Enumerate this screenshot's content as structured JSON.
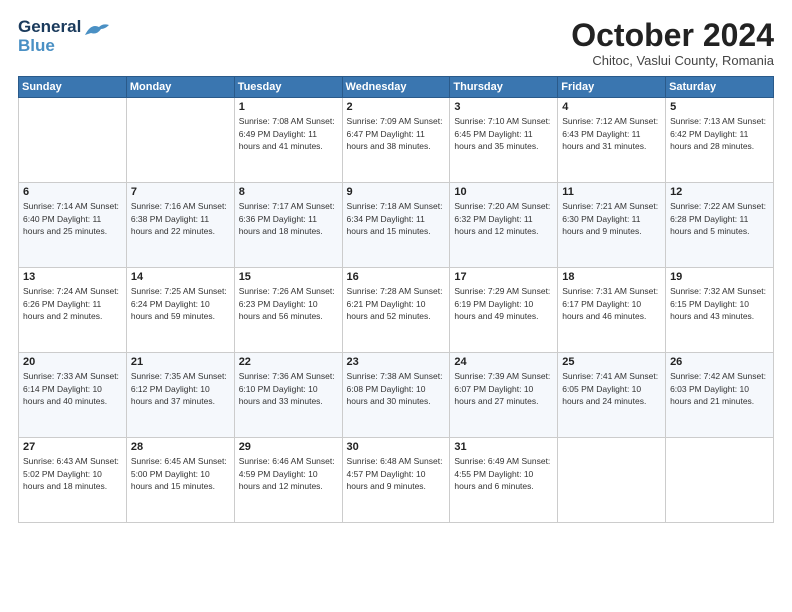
{
  "header": {
    "logo_line1": "General",
    "logo_line2": "Blue",
    "month": "October 2024",
    "location": "Chitoc, Vaslui County, Romania"
  },
  "weekdays": [
    "Sunday",
    "Monday",
    "Tuesday",
    "Wednesday",
    "Thursday",
    "Friday",
    "Saturday"
  ],
  "weeks": [
    [
      {
        "day": "",
        "info": ""
      },
      {
        "day": "",
        "info": ""
      },
      {
        "day": "1",
        "info": "Sunrise: 7:08 AM\nSunset: 6:49 PM\nDaylight: 11 hours and 41 minutes."
      },
      {
        "day": "2",
        "info": "Sunrise: 7:09 AM\nSunset: 6:47 PM\nDaylight: 11 hours and 38 minutes."
      },
      {
        "day": "3",
        "info": "Sunrise: 7:10 AM\nSunset: 6:45 PM\nDaylight: 11 hours and 35 minutes."
      },
      {
        "day": "4",
        "info": "Sunrise: 7:12 AM\nSunset: 6:43 PM\nDaylight: 11 hours and 31 minutes."
      },
      {
        "day": "5",
        "info": "Sunrise: 7:13 AM\nSunset: 6:42 PM\nDaylight: 11 hours and 28 minutes."
      }
    ],
    [
      {
        "day": "6",
        "info": "Sunrise: 7:14 AM\nSunset: 6:40 PM\nDaylight: 11 hours and 25 minutes."
      },
      {
        "day": "7",
        "info": "Sunrise: 7:16 AM\nSunset: 6:38 PM\nDaylight: 11 hours and 22 minutes."
      },
      {
        "day": "8",
        "info": "Sunrise: 7:17 AM\nSunset: 6:36 PM\nDaylight: 11 hours and 18 minutes."
      },
      {
        "day": "9",
        "info": "Sunrise: 7:18 AM\nSunset: 6:34 PM\nDaylight: 11 hours and 15 minutes."
      },
      {
        "day": "10",
        "info": "Sunrise: 7:20 AM\nSunset: 6:32 PM\nDaylight: 11 hours and 12 minutes."
      },
      {
        "day": "11",
        "info": "Sunrise: 7:21 AM\nSunset: 6:30 PM\nDaylight: 11 hours and 9 minutes."
      },
      {
        "day": "12",
        "info": "Sunrise: 7:22 AM\nSunset: 6:28 PM\nDaylight: 11 hours and 5 minutes."
      }
    ],
    [
      {
        "day": "13",
        "info": "Sunrise: 7:24 AM\nSunset: 6:26 PM\nDaylight: 11 hours and 2 minutes."
      },
      {
        "day": "14",
        "info": "Sunrise: 7:25 AM\nSunset: 6:24 PM\nDaylight: 10 hours and 59 minutes."
      },
      {
        "day": "15",
        "info": "Sunrise: 7:26 AM\nSunset: 6:23 PM\nDaylight: 10 hours and 56 minutes."
      },
      {
        "day": "16",
        "info": "Sunrise: 7:28 AM\nSunset: 6:21 PM\nDaylight: 10 hours and 52 minutes."
      },
      {
        "day": "17",
        "info": "Sunrise: 7:29 AM\nSunset: 6:19 PM\nDaylight: 10 hours and 49 minutes."
      },
      {
        "day": "18",
        "info": "Sunrise: 7:31 AM\nSunset: 6:17 PM\nDaylight: 10 hours and 46 minutes."
      },
      {
        "day": "19",
        "info": "Sunrise: 7:32 AM\nSunset: 6:15 PM\nDaylight: 10 hours and 43 minutes."
      }
    ],
    [
      {
        "day": "20",
        "info": "Sunrise: 7:33 AM\nSunset: 6:14 PM\nDaylight: 10 hours and 40 minutes."
      },
      {
        "day": "21",
        "info": "Sunrise: 7:35 AM\nSunset: 6:12 PM\nDaylight: 10 hours and 37 minutes."
      },
      {
        "day": "22",
        "info": "Sunrise: 7:36 AM\nSunset: 6:10 PM\nDaylight: 10 hours and 33 minutes."
      },
      {
        "day": "23",
        "info": "Sunrise: 7:38 AM\nSunset: 6:08 PM\nDaylight: 10 hours and 30 minutes."
      },
      {
        "day": "24",
        "info": "Sunrise: 7:39 AM\nSunset: 6:07 PM\nDaylight: 10 hours and 27 minutes."
      },
      {
        "day": "25",
        "info": "Sunrise: 7:41 AM\nSunset: 6:05 PM\nDaylight: 10 hours and 24 minutes."
      },
      {
        "day": "26",
        "info": "Sunrise: 7:42 AM\nSunset: 6:03 PM\nDaylight: 10 hours and 21 minutes."
      }
    ],
    [
      {
        "day": "27",
        "info": "Sunrise: 6:43 AM\nSunset: 5:02 PM\nDaylight: 10 hours and 18 minutes."
      },
      {
        "day": "28",
        "info": "Sunrise: 6:45 AM\nSunset: 5:00 PM\nDaylight: 10 hours and 15 minutes."
      },
      {
        "day": "29",
        "info": "Sunrise: 6:46 AM\nSunset: 4:59 PM\nDaylight: 10 hours and 12 minutes."
      },
      {
        "day": "30",
        "info": "Sunrise: 6:48 AM\nSunset: 4:57 PM\nDaylight: 10 hours and 9 minutes."
      },
      {
        "day": "31",
        "info": "Sunrise: 6:49 AM\nSunset: 4:55 PM\nDaylight: 10 hours and 6 minutes."
      },
      {
        "day": "",
        "info": ""
      },
      {
        "day": "",
        "info": ""
      }
    ]
  ]
}
